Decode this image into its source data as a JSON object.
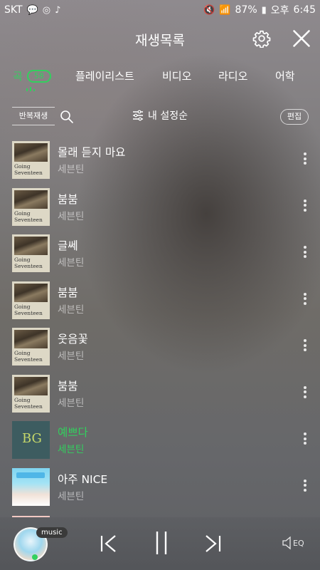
{
  "status": {
    "carrier": "SKT",
    "battery": "87%",
    "ampm": "오후",
    "time": "6:45"
  },
  "header": {
    "title": "재생목록",
    "settings_icon": "gear-icon",
    "close_icon": "close-icon"
  },
  "tabs": [
    {
      "label": "곡",
      "count": "58",
      "active": true
    },
    {
      "label": "플레이리스트"
    },
    {
      "label": "비디오"
    },
    {
      "label": "라디오"
    },
    {
      "label": "어학"
    }
  ],
  "toolbar": {
    "repeat_label": "반복재생",
    "sort_label": "내 설정순",
    "edit_label": "편집"
  },
  "tracks": [
    {
      "title": "몰래 듣지 마요",
      "artist": "세븐틴",
      "album_art": "Going Seventeen"
    },
    {
      "title": "붐붐",
      "artist": "세븐틴",
      "album_art": "Going Seventeen"
    },
    {
      "title": "글쎄",
      "artist": "세븐틴",
      "album_art": "Going Seventeen"
    },
    {
      "title": "붐붐",
      "artist": "세븐틴",
      "album_art": "Going Seventeen"
    },
    {
      "title": "웃음꽃",
      "artist": "세븐틴",
      "album_art": "Going Seventeen"
    },
    {
      "title": "붐붐",
      "artist": "세븐틴",
      "album_art": "Going Seventeen"
    },
    {
      "title": "예쁘다",
      "artist": "세븐틴",
      "album_art": "teal",
      "playing": true
    },
    {
      "title": "아주 NICE",
      "artist": "세븐틴",
      "album_art": "bright"
    }
  ],
  "player": {
    "badge": "music",
    "eq_label": "EQ"
  },
  "colors": {
    "accent": "#32d05e"
  }
}
